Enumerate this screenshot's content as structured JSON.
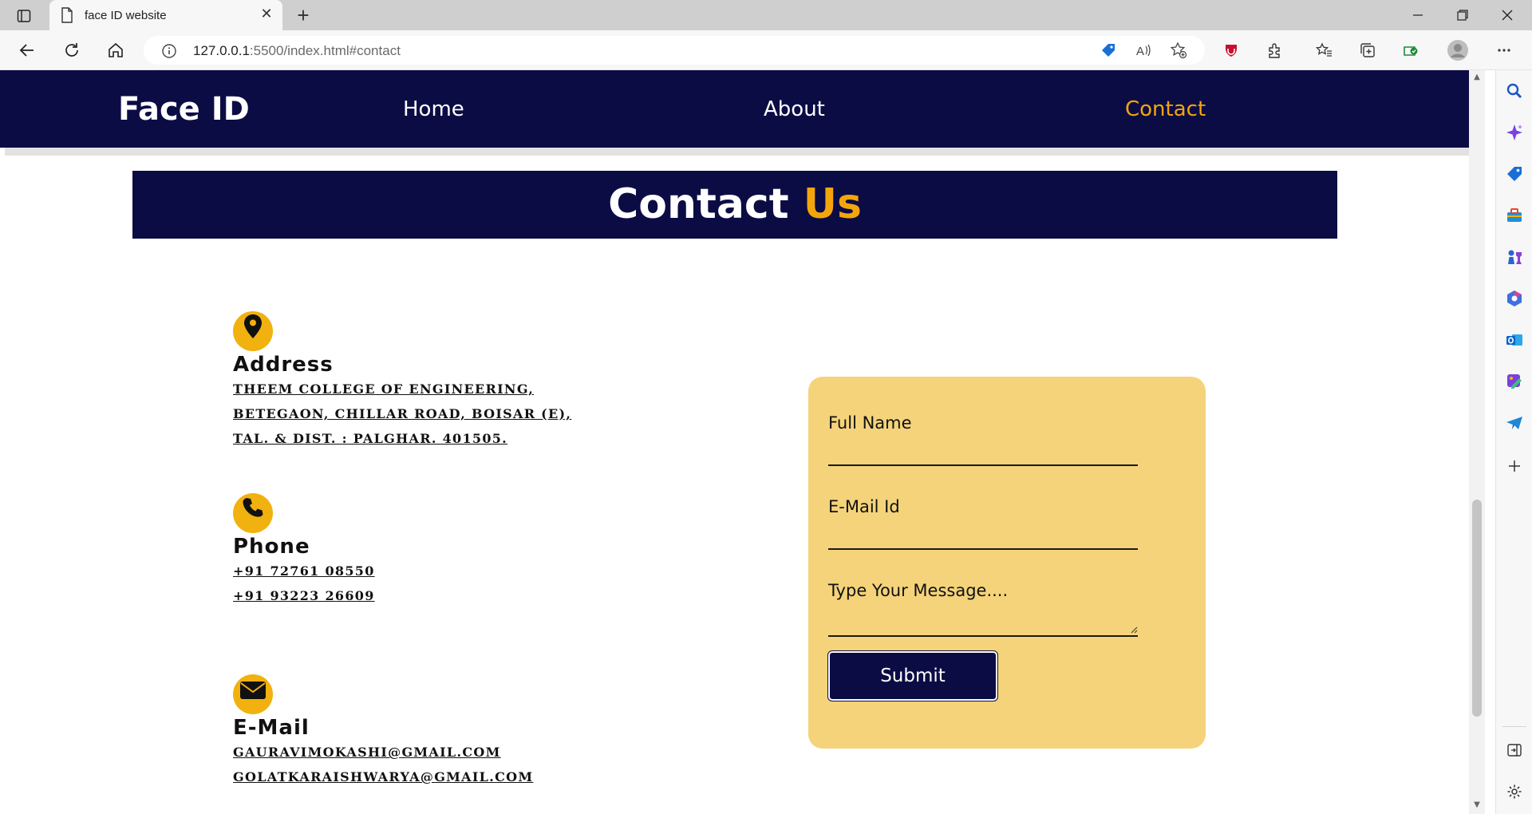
{
  "browser": {
    "tab_title": "face ID website",
    "url_host": "127.0.0.1",
    "url_rest": ":5500/index.html#contact"
  },
  "site": {
    "brand": "Face ID",
    "nav": [
      "Home",
      "About",
      "Contact"
    ],
    "active_nav": "Contact",
    "accent_color": "#f3a60c",
    "navy_color": "#0c0c45"
  },
  "contact": {
    "heading_main": "Contact",
    "heading_accent": "Us",
    "address": {
      "icon": "map-pin-icon",
      "title": "Address",
      "lines": [
        "THEEM COLLEGE OF ENGINEERING,",
        "BETEGAON, CHILLAR ROAD, BOISAR (E),",
        "TAL. & DIST. : PALGHAR. 401505."
      ]
    },
    "phone": {
      "icon": "phone-icon",
      "title": "Phone",
      "lines": [
        "+91 72761 08550",
        "+91 93223 26609"
      ]
    },
    "email": {
      "icon": "envelope-icon",
      "title": "E-Mail",
      "lines": [
        "GAURAVIMOKASHI@GMAIL.COM",
        "GOLATKARAISHWARYA@GMAIL.COM"
      ]
    }
  },
  "form": {
    "full_name_label": "Full Name",
    "email_label": "E-Mail Id",
    "message_label": "Type Your Message....",
    "submit_label": "Submit",
    "card_color": "#f4d37a"
  }
}
